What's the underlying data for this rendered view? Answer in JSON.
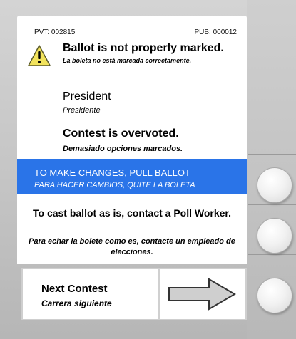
{
  "counters": {
    "pvt": "PVT: 002815",
    "pub": "PUB: 000012"
  },
  "warning": {
    "title": "Ballot is not properly marked.",
    "subtitle": "La boleta no está marcada correctamente.",
    "icon": "warning-icon"
  },
  "contest": {
    "name": "President",
    "name_es": "Presidente",
    "status": "Contest is overvoted.",
    "status_es": "Demasiado opciones marcados."
  },
  "banner": {
    "line1": "TO MAKE CHANGES, PULL BALLOT",
    "line2": "PARA HACER CAMBIOS, QUITE LA BOLETA",
    "color": "#2a74e8"
  },
  "cast": {
    "message": "To cast ballot as is, contact a Poll Worker.",
    "message_es": "Para echar la bolete como es, contacte un empleado de elecciones."
  },
  "next": {
    "label": "Next Contest",
    "label_es": "Carrera siguiente",
    "icon": "right-arrow-icon"
  }
}
